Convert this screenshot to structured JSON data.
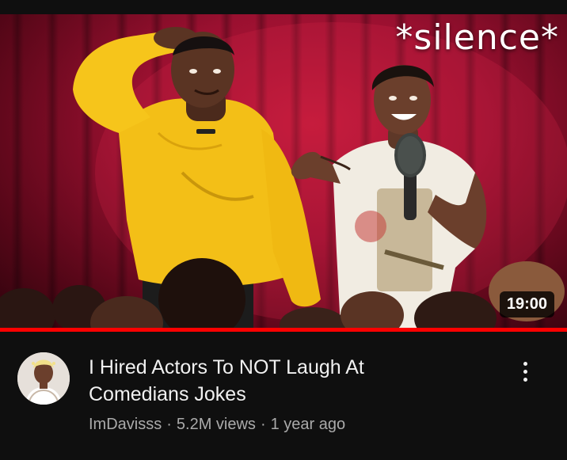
{
  "video": {
    "overlay_text": "*silence*",
    "duration": "19:00",
    "watch_progress": 1.0,
    "title": "I Hired Actors To NOT Laugh At Comedians Jokes",
    "channel": "ImDavisss",
    "views": "5.2M views",
    "age": "1 year ago",
    "separator": "·"
  },
  "icons": {
    "more": "more-vert-icon"
  },
  "colors": {
    "background": "#0f0f0f",
    "progress": "#ff0000",
    "secondary_text": "#aaaaaa",
    "curtain": "#9a1030",
    "hoodie": "#f6c51b"
  }
}
